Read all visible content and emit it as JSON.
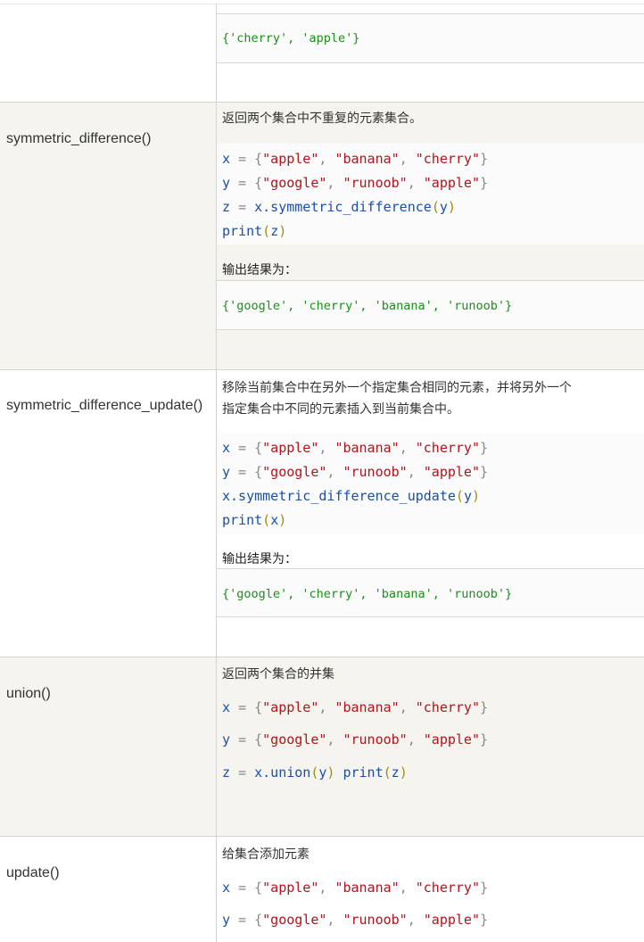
{
  "rows": [
    {
      "output": "{'cherry', 'apple'}"
    },
    {
      "name": "symmetric_difference()",
      "description": "返回两个集合中不重复的元素集合。",
      "code": [
        [
          "x",
          " = ",
          "{",
          "\"apple\"",
          ", ",
          "\"banana\"",
          ", ",
          "\"cherry\"",
          "}"
        ],
        [
          "y",
          " = ",
          "{",
          "\"google\"",
          ", ",
          "\"runoob\"",
          ", ",
          "\"apple\"",
          "}"
        ],
        [
          "z",
          " = ",
          "x.symmetric_difference",
          "(",
          "y",
          ")"
        ],
        [
          "print",
          "(",
          "z",
          ")"
        ]
      ],
      "output_label": "输出结果为：",
      "output": "{'google', 'cherry', 'banana', 'runoob'}"
    },
    {
      "name": "symmetric_difference_update()",
      "description_lines": [
        "移除当前集合中在另外一个指定集合相同的元素，并将另外一个",
        "指定集合中不同的元素插入到当前集合中。"
      ],
      "code": [
        [
          "x",
          " = ",
          "{",
          "\"apple\"",
          ", ",
          "\"banana\"",
          ", ",
          "\"cherry\"",
          "}"
        ],
        [
          "y",
          " = ",
          "{",
          "\"google\"",
          ", ",
          "\"runoob\"",
          ", ",
          "\"apple\"",
          "}"
        ],
        [
          "x.symmetric_difference_update",
          "(",
          "y",
          ")"
        ],
        [
          "print",
          "(",
          "x",
          ")"
        ]
      ],
      "output_label": "输出结果为：",
      "output": "{'google', 'cherry', 'banana', 'runoob'}"
    },
    {
      "name": "union()",
      "description": "返回两个集合的并集",
      "code": [
        [
          "x",
          " = ",
          "{",
          "\"apple\"",
          ", ",
          "\"banana\"",
          ", ",
          "\"cherry\"",
          "}"
        ],
        [
          "y",
          " = ",
          "{",
          "\"google\"",
          ", ",
          "\"runoob\"",
          ", ",
          "\"apple\"",
          "}"
        ],
        [
          "z",
          " = ",
          "x.union",
          "(",
          "y",
          ")",
          " ",
          "print",
          "(",
          "z",
          ")"
        ]
      ]
    },
    {
      "name": "update()",
      "description": "给集合添加元素",
      "code": [
        [
          "x",
          " = ",
          "{",
          "\"apple\"",
          ", ",
          "\"banana\"",
          ", ",
          "\"cherry\"",
          "}"
        ],
        [
          "y",
          " = ",
          "{",
          "\"google\"",
          ", ",
          "\"runoob\"",
          ", ",
          "\"apple\"",
          "}"
        ]
      ]
    }
  ]
}
